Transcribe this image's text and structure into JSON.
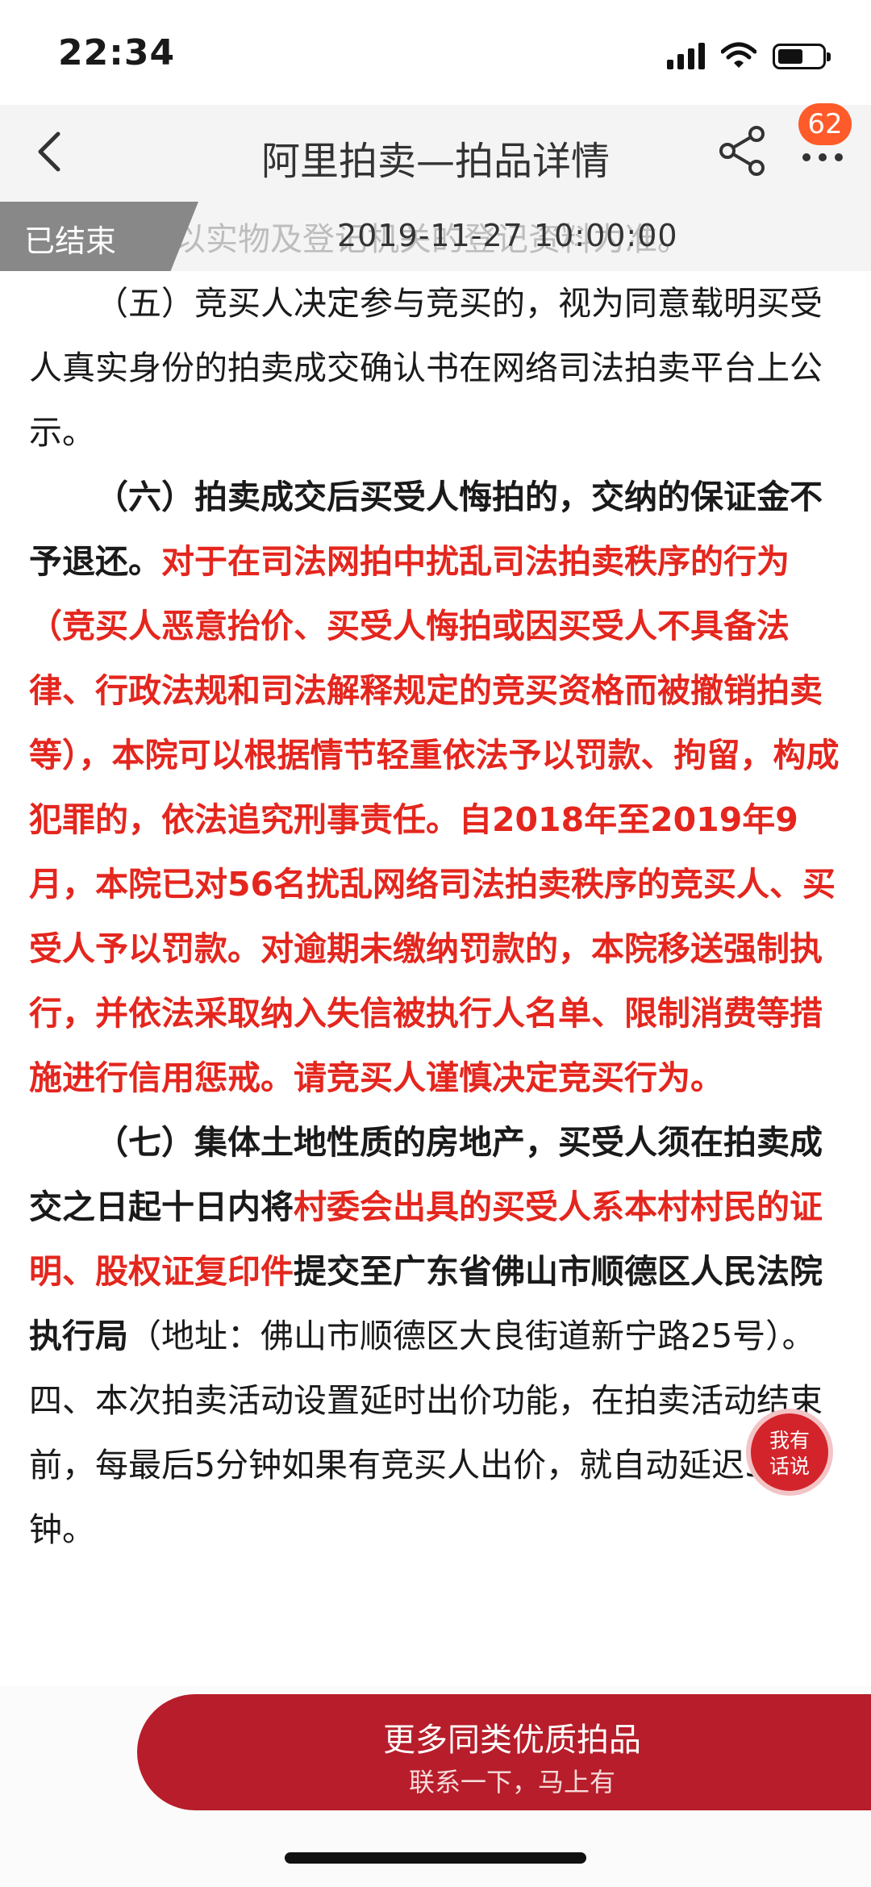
{
  "status_bar": {
    "time": "22:34",
    "battery_level": 0.62
  },
  "nav": {
    "title": "阿里拍卖—拍品详情",
    "badge_count": "62"
  },
  "countdown": {
    "status_label": "已结束",
    "end_time": "2019-11-27 10:00:00",
    "ghost_text": "况以实物及登记机关的登记资料为准。"
  },
  "content": {
    "p1": "（五）竞买人决定参与竞买的，视为同意载明买受人真实身份的拍卖成交确认书在网络司法拍卖平台上公示。",
    "p2_bold": "（六）拍卖成交后买受人悔拍的，交纳的保证金不予退还。",
    "p2_red": "对于在司法网拍中扰乱司法拍卖秩序的行为（竞买人恶意抬价、买受人悔拍或因买受人不具备法律、行政法规和司法解释规定的竞买资格而被撤销拍卖等），本院可以根据情节轻重依法予以罚款、拘留，构成犯罪的，依法追究刑事责任。自2018年至2019年9月，本院已对56名扰乱网络司法拍卖秩序的竞买人、买受人予以罚款。对逾期未缴纳罚款的，本院移送强制执行，并依法采取纳入失信被执行人名单、限制消费等措施进行信用惩戒。请竞买人谨慎决定竞买行为。",
    "p3_bold_a": "（七）集体土地性质的房地产，买受人须在拍卖成交之日起十日内将",
    "p3_red": "村委会出具的买受人系本村村民的证明、股权证复印件",
    "p3_bold_b": "提交至广东省佛山市顺德区人民法院执行局",
    "p3_plain": "（地址：佛山市顺德区大良街道新宁路25号）。",
    "p4": "四、本次拍卖活动设置延时出价功能，在拍卖活动结束前，每最后5分钟如果有竞买人出价，就自动延迟5分钟。"
  },
  "chat_button": {
    "line1": "我有",
    "line2": "话说"
  },
  "cta": {
    "title": "更多同类优质拍品",
    "subtitle": "联系一下，马上有"
  },
  "colors": {
    "accent_red": "#e4261e",
    "cta_bg": "#b71d2a",
    "badge": "#ff5a2a"
  }
}
